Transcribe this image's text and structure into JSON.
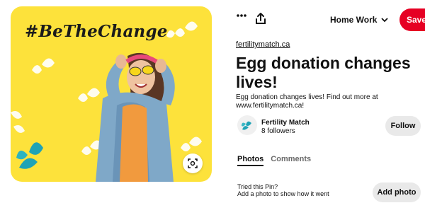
{
  "pin": {
    "image_hashtag": "#BeTheChange",
    "source_link": "fertilitymatch.ca",
    "title": "Egg donation changes lives!",
    "description": "Egg donation changes lives! Find out more at www.fertilitymatch.ca!"
  },
  "toolbar": {
    "more_icon": "more-horizontal-icon",
    "share_icon": "share-upload-icon",
    "board_name": "Home Work",
    "save_label": "Save"
  },
  "creator": {
    "name": "Fertility Match",
    "followers": "8 followers",
    "follow_label": "Follow"
  },
  "tabs": {
    "photos": "Photos",
    "comments": "Comments"
  },
  "tried": {
    "title": "Tried this Pin?",
    "subtitle": "Add a photo to show how it went",
    "add_photo_label": "Add photo"
  },
  "colors": {
    "save": "#e60023",
    "image_background": "#fde23b",
    "brand_teal": "#1fa3b6"
  }
}
